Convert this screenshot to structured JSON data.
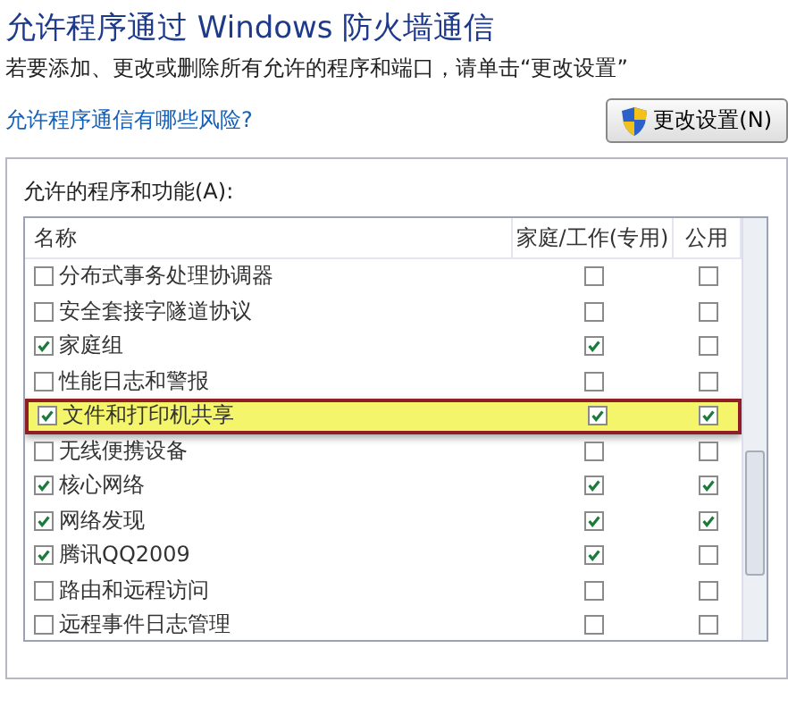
{
  "title": "允许程序通过 Windows 防火墙通信",
  "subtitle": "若要添加、更改或删除所有允许的程序和端口，请单击“更改设置”",
  "risk_link": "允许程序通信有哪些风险?",
  "change_button": "更改设置(N)",
  "group_label": "允许的程序和功能(A):",
  "table": {
    "columns": [
      "名称",
      "家庭/工作(专用)",
      "公用"
    ],
    "rows": [
      {
        "name": "分布式事务处理协调器",
        "checked": false,
        "home": false,
        "public": false,
        "highlighted": false
      },
      {
        "name": "安全套接字隧道协议",
        "checked": false,
        "home": false,
        "public": false,
        "highlighted": false
      },
      {
        "name": "家庭组",
        "checked": true,
        "home": true,
        "public": false,
        "highlighted": false
      },
      {
        "name": "性能日志和警报",
        "checked": false,
        "home": false,
        "public": false,
        "highlighted": false
      },
      {
        "name": "文件和打印机共享",
        "checked": true,
        "home": true,
        "public": true,
        "highlighted": true
      },
      {
        "name": "无线便携设备",
        "checked": false,
        "home": false,
        "public": false,
        "highlighted": false
      },
      {
        "name": "核心网络",
        "checked": true,
        "home": true,
        "public": true,
        "highlighted": false
      },
      {
        "name": "网络发现",
        "checked": true,
        "home": true,
        "public": true,
        "highlighted": false
      },
      {
        "name": "腾讯QQ2009",
        "checked": true,
        "home": true,
        "public": false,
        "highlighted": false
      },
      {
        "name": "路由和远程访问",
        "checked": false,
        "home": false,
        "public": false,
        "highlighted": false
      },
      {
        "name": "远程事件日志管理",
        "checked": false,
        "home": false,
        "public": false,
        "highlighted": false
      }
    ]
  }
}
